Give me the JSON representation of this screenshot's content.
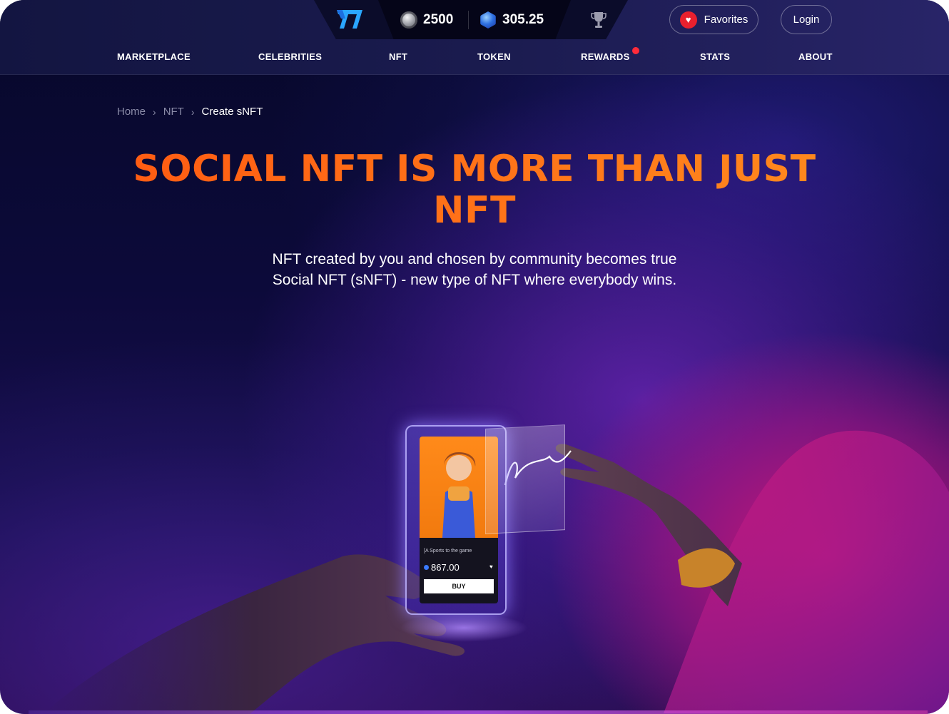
{
  "header": {
    "silver_balance": "2500",
    "gem_balance": "305.25",
    "favorites_label": "Favorites",
    "login_label": "Login"
  },
  "nav": {
    "items": [
      {
        "label": "MARKETPLACE"
      },
      {
        "label": "CELEBRITIES"
      },
      {
        "label": "NFT"
      },
      {
        "label": "TOKEN"
      },
      {
        "label": "REWARDS",
        "has_notification": true
      },
      {
        "label": "STATS"
      },
      {
        "label": "ABOUT"
      }
    ]
  },
  "breadcrumb": {
    "items": [
      "Home",
      "NFT"
    ],
    "current": "Create sNFT"
  },
  "hero": {
    "title": "SOCIAL NFT IS MORE THAN JUST NFT",
    "subtitle_line1": "NFT created by you and chosen by community becomes true",
    "subtitle_line2": "Social NFT (sNFT) - new type of NFT where everybody wins."
  },
  "illustration": {
    "card_caption": "[A Sports to the game",
    "card_price": "867.00",
    "card_button": "BUY"
  },
  "colors": {
    "accent_orange": "#ff7a1a",
    "favorite_red": "#e8202e",
    "notification_red": "#ff2b3a",
    "background_dark": "#0c0a3a"
  },
  "icons": {
    "logo": "brand-logo-icon",
    "silver": "silver-coin-icon",
    "gem": "gem-icon",
    "trophy": "trophy-icon",
    "heart": "heart-icon"
  }
}
